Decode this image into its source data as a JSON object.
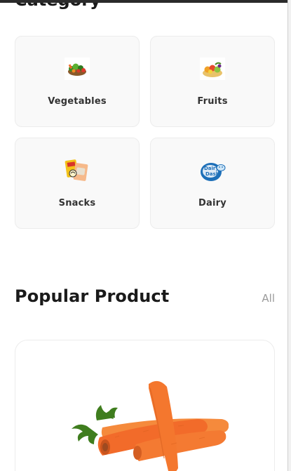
{
  "categories_section": {
    "title": "Category"
  },
  "categories": [
    {
      "label": "Vegetables",
      "icon": "vegetables-icon"
    },
    {
      "label": "Fruits",
      "icon": "fruits-icon"
    },
    {
      "label": "Snacks",
      "icon": "snacks-icon"
    },
    {
      "label": "Dairy",
      "icon": "dairy-icon"
    }
  ],
  "popular": {
    "title": "Popular Product",
    "all_label": "All"
  },
  "products": [
    {
      "image": "carrots"
    }
  ],
  "colors": {
    "background": "#ffffff",
    "card_background": "#f9f9f9",
    "card_border": "#ececec",
    "title": "#1a1a1a",
    "muted": "#9a9a9a",
    "carrot": "#f26b2a",
    "leaf": "#3f7d1e"
  }
}
